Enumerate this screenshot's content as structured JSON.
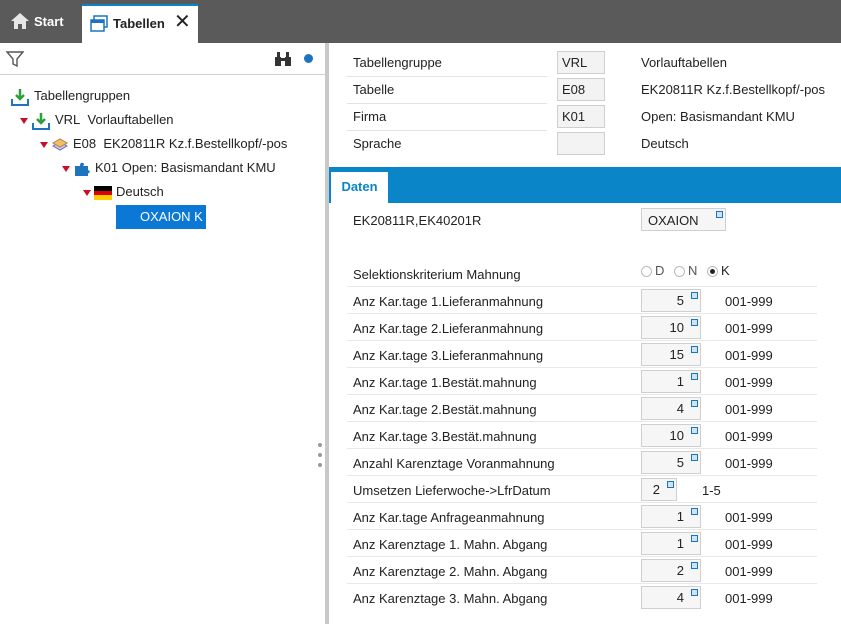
{
  "tabs": [
    {
      "label": "Start"
    },
    {
      "label": "Tabellen"
    }
  ],
  "tree": {
    "root": "Tabellengruppen",
    "group": {
      "code": "VRL",
      "label": "Vorlauftabellen"
    },
    "table": {
      "code": "E08",
      "label": "EK20811R Kz.f.Bestellkopf/-pos"
    },
    "company": {
      "code": "K01",
      "label": "Open: Basismandant KMU"
    },
    "language": "Deutsch",
    "selected": "OXAION  K"
  },
  "header": {
    "rows": [
      {
        "label": "Tabellengruppe",
        "value": "VRL",
        "desc": "Vorlauftabellen"
      },
      {
        "label": "Tabelle",
        "value": "E08",
        "desc": "EK20811R Kz.f.Bestellkopf/-pos"
      },
      {
        "label": "Firma",
        "value": "K01",
        "desc": "Open: Basismandant KMU"
      },
      {
        "label": "Sprache",
        "value": "",
        "desc": "Deutsch"
      }
    ]
  },
  "section_tab": "Daten",
  "db": {
    "label": "EK20811R,EK40201R",
    "value": "OXAION"
  },
  "selection": {
    "label": "Selektionskriterium Mahnung",
    "options": [
      "D",
      "N",
      "K"
    ],
    "selected": "K"
  },
  "fields": [
    {
      "label": "Anz Kar.tage 1.Lieferanmahnung",
      "value": "5",
      "range": "001-999"
    },
    {
      "label": "Anz Kar.tage 2.Lieferanmahnung",
      "value": "10",
      "range": "001-999"
    },
    {
      "label": "Anz Kar.tage 3.Lieferanmahnung",
      "value": "15",
      "range": "001-999"
    },
    {
      "label": "Anz Kar.tage 1.Bestät.mahnung",
      "value": "1",
      "range": "001-999"
    },
    {
      "label": "Anz Kar.tage 2.Bestät.mahnung",
      "value": "4",
      "range": "001-999"
    },
    {
      "label": "Anz Kar.tage 3.Bestät.mahnung",
      "value": "10",
      "range": "001-999"
    },
    {
      "label": "Anzahl Karenztage Voranmahnung",
      "value": "5",
      "range": "001-999"
    },
    {
      "label": "Umsetzen Lieferwoche->LfrDatum",
      "value": "2",
      "range": "1-5"
    },
    {
      "label": "Anz Kar.tage Anfrageanmahnung",
      "value": "1",
      "range": "001-999"
    },
    {
      "label": "Anz Karenztage 1. Mahn. Abgang",
      "value": "1",
      "range": "001-999"
    },
    {
      "label": "Anz Karenztage 2. Mahn. Abgang",
      "value": "2",
      "range": "001-999"
    },
    {
      "label": "Anz Karenztage 3. Mahn. Abgang",
      "value": "4",
      "range": "001-999"
    }
  ],
  "colors": {
    "accent": "#0a85c7",
    "selection": "#0a78d4",
    "topbar": "#5a5a5a"
  }
}
